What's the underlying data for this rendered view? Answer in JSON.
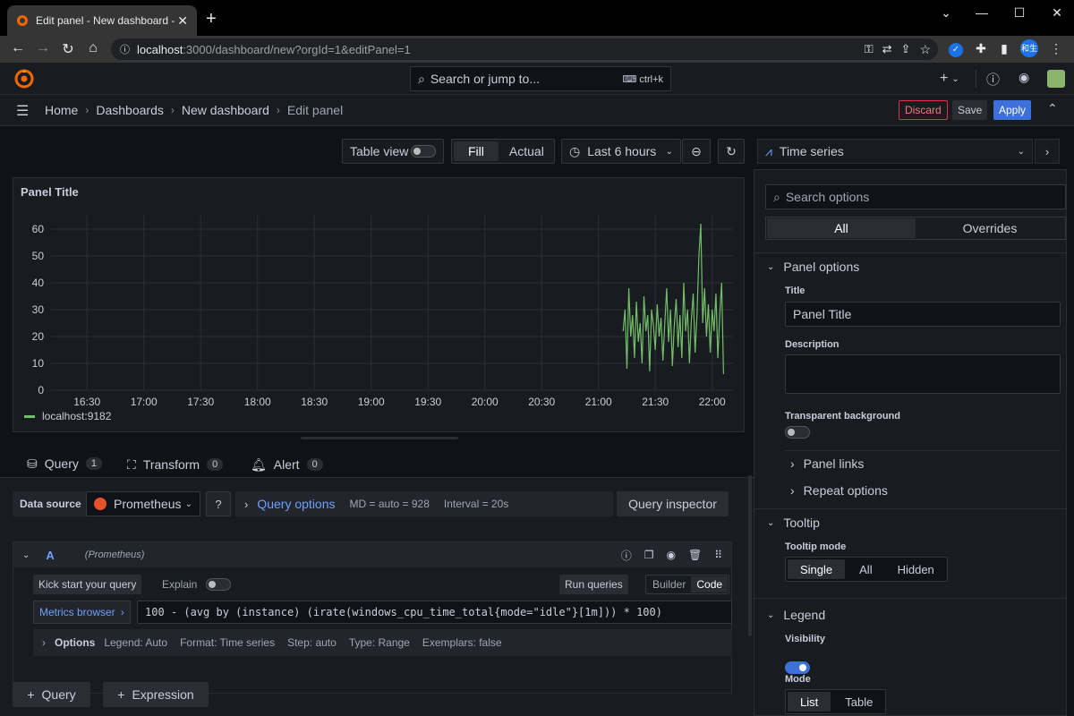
{
  "browser": {
    "tab_title": "Edit panel - New dashboard - Da",
    "url_host": "localhost",
    "url_path": ":3000/dashboard/new?orgId=1&editPanel=1",
    "profile": "和生"
  },
  "topbar": {
    "search_placeholder": "Search or jump to...",
    "search_shortcut": "ctrl+k",
    "plus": "+"
  },
  "breadcrumbs": [
    "Home",
    "Dashboards",
    "New dashboard",
    "Edit panel"
  ],
  "actions": {
    "discard": "Discard",
    "save": "Save",
    "apply": "Apply"
  },
  "toolbar": {
    "table_view": "Table view",
    "fill": "Fill",
    "actual": "Actual",
    "time_range": "Last 6 hours"
  },
  "panel": {
    "title": "Panel Title",
    "legend": "localhost:9182"
  },
  "chart_data": {
    "type": "line",
    "title": "Panel Title",
    "x_ticks": [
      "16:30",
      "17:00",
      "17:30",
      "18:00",
      "18:30",
      "19:00",
      "19:30",
      "20:00",
      "20:30",
      "21:00",
      "21:30",
      "22:00"
    ],
    "y_ticks": [
      0,
      10,
      20,
      30,
      40,
      50,
      60
    ],
    "ylim": [
      0,
      65
    ],
    "series": [
      {
        "name": "localhost:9182",
        "color": "#73bf69",
        "x": [
          "21:13",
          "21:14",
          "21:15",
          "21:16",
          "21:17",
          "21:18",
          "21:19",
          "21:20",
          "21:21",
          "21:22",
          "21:23",
          "21:24",
          "21:25",
          "21:26",
          "21:27",
          "21:28",
          "21:29",
          "21:30",
          "21:31",
          "21:32",
          "21:33",
          "21:34",
          "21:35",
          "21:36",
          "21:37",
          "21:38",
          "21:39",
          "21:40",
          "21:41",
          "21:42",
          "21:43",
          "21:44",
          "21:45",
          "21:46",
          "21:47",
          "21:48",
          "21:49",
          "21:50",
          "21:51",
          "21:52",
          "21:53",
          "21:54",
          "21:55",
          "21:56",
          "21:57",
          "21:58",
          "21:59",
          "22:00",
          "22:01",
          "22:02",
          "22:03",
          "22:04",
          "22:05",
          "22:06"
        ],
        "values": [
          22,
          30,
          8,
          38,
          20,
          28,
          12,
          33,
          18,
          25,
          10,
          35,
          22,
          28,
          7,
          30,
          24,
          15,
          32,
          20,
          27,
          11,
          25,
          38,
          18,
          30,
          9,
          24,
          34,
          16,
          28,
          12,
          40,
          22,
          30,
          10,
          26,
          36,
          14,
          28,
          50,
          62,
          25,
          38,
          20,
          32,
          14,
          30,
          22,
          36,
          12,
          28,
          40,
          6
        ]
      }
    ],
    "legend": "bottom-left"
  },
  "query_tabs": [
    {
      "label": "Query",
      "count": "1"
    },
    {
      "label": "Transform",
      "count": "0"
    },
    {
      "label": "Alert",
      "count": "0"
    }
  ],
  "datasource": {
    "label": "Data source",
    "value": "Prometheus",
    "query_options": "Query options",
    "md": "MD = auto = 928",
    "interval": "Interval = 20s",
    "inspector": "Query inspector"
  },
  "query": {
    "ref": "A",
    "ds": "(Prometheus)",
    "kickstart": "Kick start your query",
    "explain": "Explain",
    "run": "Run queries",
    "builder": "Builder",
    "code": "Code",
    "metrics_browser": "Metrics browser",
    "expr": "100 - (avg by (instance) (irate(windows_cpu_time_total{mode=\"idle\"}[1m])) * 100)",
    "options_label": "Options",
    "legend": "Legend: Auto",
    "format": "Format: Time series",
    "step": "Step: auto",
    "type": "Type: Range",
    "exemplars": "Exemplars: false"
  },
  "add": {
    "query": "Query",
    "expression": "Expression"
  },
  "right": {
    "viz": "Time series",
    "search_placeholder": "Search options",
    "tab_all": "All",
    "tab_overrides": "Overrides",
    "panel_options": "Panel options",
    "title_label": "Title",
    "title_value": "Panel Title",
    "description_label": "Description",
    "transparent_label": "Transparent background",
    "panel_links": "Panel links",
    "repeat_options": "Repeat options",
    "tooltip": "Tooltip",
    "tooltip_mode": "Tooltip mode",
    "tooltip_opts": [
      "Single",
      "All",
      "Hidden"
    ],
    "legend": "Legend",
    "visibility": "Visibility",
    "mode": "Mode",
    "mode_opts": [
      "List",
      "Table"
    ]
  }
}
